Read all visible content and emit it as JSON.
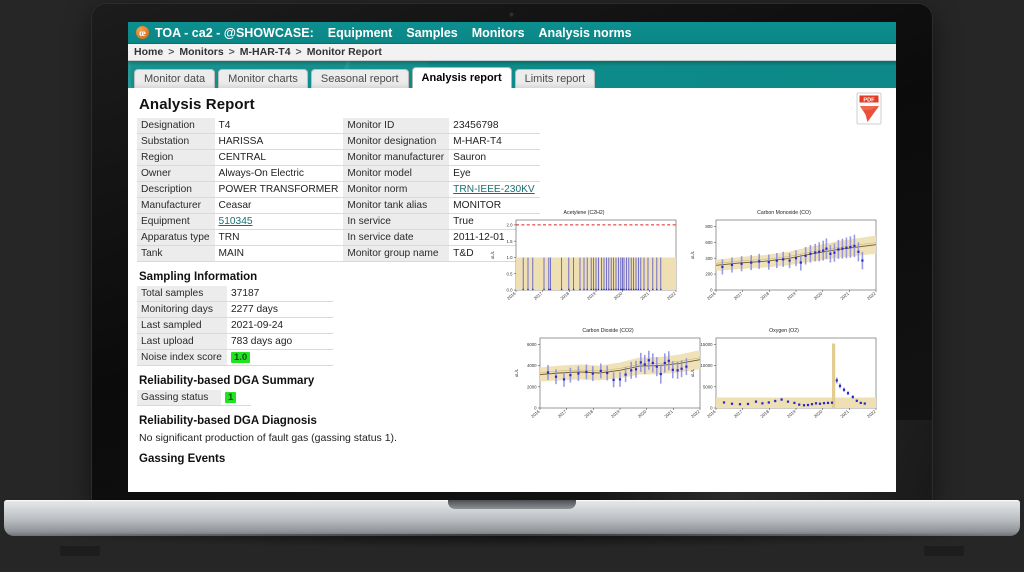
{
  "menubar": {
    "logo_text": "œ",
    "title": "TOA - ca2 - @SHOWCASE:",
    "items": [
      {
        "label": "Equipment"
      },
      {
        "label": "Samples"
      },
      {
        "label": "Monitors"
      },
      {
        "label": "Analysis norms"
      }
    ]
  },
  "breadcrumb": {
    "separator": ">",
    "items": [
      {
        "label": "Home"
      },
      {
        "label": "Monitors"
      },
      {
        "label": "M-HAR-T4"
      },
      {
        "label": "Monitor Report"
      }
    ]
  },
  "tabs": [
    {
      "label": "Monitor data",
      "active": false
    },
    {
      "label": "Monitor charts",
      "active": false
    },
    {
      "label": "Seasonal report",
      "active": false
    },
    {
      "label": "Analysis report",
      "active": true
    },
    {
      "label": "Limits report",
      "active": false
    }
  ],
  "export": {
    "icon": "pdf-icon",
    "label": "PDF"
  },
  "report": {
    "title": "Analysis Report",
    "info_rows": [
      {
        "k1": "Designation",
        "v1": "T4",
        "k2": "Monitor ID",
        "v2": "23456798"
      },
      {
        "k1": "Substation",
        "v1": "HARISSA",
        "k2": "Monitor designation",
        "v2": "M-HAR-T4"
      },
      {
        "k1": "Region",
        "v1": "CENTRAL",
        "k2": "Monitor manufacturer",
        "v2": "Sauron"
      },
      {
        "k1": "Owner",
        "v1": "Always-On Electric",
        "k2": "Monitor model",
        "v2": "Eye"
      },
      {
        "k1": "Description",
        "v1": "POWER TRANSFORMER",
        "k2": "Monitor norm",
        "v2": "TRN-IEEE-230KV",
        "v2_link": true
      },
      {
        "k1": "Manufacturer",
        "v1": "Ceasar",
        "k2": "Monitor tank alias",
        "v2": "MONITOR"
      },
      {
        "k1": "Equipment",
        "v1": "510345",
        "v1_link": true,
        "k2": "In service",
        "v2": "True"
      },
      {
        "k1": "Apparatus type",
        "v1": "TRN",
        "k2": "In service date",
        "v2": "2011-12-01"
      },
      {
        "k1": "Tank",
        "v1": "MAIN",
        "k2": "Monitor group name",
        "v2": "T&D"
      }
    ],
    "sampling": {
      "heading": "Sampling Information",
      "rows": [
        {
          "k": "Total samples",
          "v": "37187"
        },
        {
          "k": "Monitoring days",
          "v": "2277 days"
        },
        {
          "k": "Last sampled",
          "v": "2021-09-24"
        },
        {
          "k": "Last upload",
          "v": "783 days ago"
        },
        {
          "k": "Noise index score",
          "v": "1.0",
          "badge": true
        }
      ]
    },
    "dga_summary": {
      "heading": "Reliability-based DGA Summary",
      "rows": [
        {
          "k": "Gassing status",
          "v": "1",
          "badge": true
        }
      ]
    },
    "dga_diagnosis": {
      "heading": "Reliability-based DGA Diagnosis",
      "text": "No significant production of fault gas (gassing status 1)."
    },
    "gassing_events": {
      "heading": "Gassing Events"
    }
  },
  "colors": {
    "teal": "#0d8f8f",
    "badge_green": "#21e321",
    "band_tan": "#efe0b4",
    "marker_blue": "#2828c8",
    "trend_dark": "#6b5d20",
    "limit_red": "#e02020",
    "link": "#1a6f73"
  },
  "chart_data": [
    {
      "type": "scatter",
      "title": "Acetylene (C2H2)",
      "ylabel": "uL/L",
      "xlabel": "",
      "ylim": [
        0.0,
        2.15
      ],
      "yticks": [
        "0.0",
        "0.5",
        "1.0",
        "1.5",
        "2.0"
      ],
      "ytick_values": [
        0.0,
        0.5,
        1.0,
        1.5,
        2.0
      ],
      "xticks": [
        "2016",
        "2017",
        "2018",
        "2019",
        "2020",
        "2021",
        "2022"
      ],
      "limit_line": {
        "value": 2.0,
        "color": "#e02020",
        "style": "dashed"
      },
      "band": {
        "lower": 0.0,
        "upper": 1.0,
        "color": "#efe0b4"
      },
      "spikes_x": [
        0.045,
        0.075,
        0.105,
        0.175,
        0.205,
        0.215,
        0.285,
        0.33,
        0.36,
        0.4,
        0.425,
        0.445,
        0.47,
        0.485,
        0.5,
        0.515,
        0.535,
        0.55,
        0.565,
        0.58,
        0.595,
        0.61,
        0.625,
        0.64,
        0.655,
        0.665,
        0.675,
        0.69,
        0.705,
        0.72,
        0.735,
        0.75,
        0.765,
        0.78,
        0.8,
        0.825,
        0.855,
        0.88,
        0.905
      ],
      "spike_top": 1.0
    },
    {
      "type": "scatter",
      "title": "Carbon Monoxide (CO)",
      "ylabel": "uL/L",
      "xlabel": "",
      "ylim": [
        0,
        880
      ],
      "yticks": [
        "0",
        "200",
        "400",
        "600",
        "800"
      ],
      "ytick_values": [
        0,
        200,
        400,
        600,
        800
      ],
      "xticks": [
        "2016",
        "2017",
        "2018",
        "2019",
        "2020",
        "2021",
        "2022"
      ],
      "series": [
        {
          "name": "measurements",
          "x": [
            0.04,
            0.1,
            0.16,
            0.22,
            0.27,
            0.33,
            0.38,
            0.42,
            0.46,
            0.5,
            0.53,
            0.56,
            0.59,
            0.62,
            0.645,
            0.67,
            0.69,
            0.715,
            0.74,
            0.765,
            0.79,
            0.815,
            0.84,
            0.865,
            0.89,
            0.915
          ],
          "y": [
            290,
            315,
            330,
            345,
            360,
            350,
            370,
            385,
            370,
            400,
            345,
            430,
            455,
            470,
            480,
            495,
            520,
            455,
            470,
            510,
            520,
            530,
            540,
            555,
            480,
            370
          ],
          "yerr": [
            95,
            95,
            95,
            95,
            95,
            95,
            95,
            95,
            95,
            100,
            100,
            110,
            110,
            110,
            120,
            125,
            130,
            110,
            115,
            120,
            125,
            130,
            135,
            140,
            120,
            110
          ]
        },
        {
          "name": "trend",
          "x": [
            0.0,
            0.15,
            0.3,
            0.45,
            0.6,
            0.75,
            0.9,
            1.0
          ],
          "y": [
            310,
            340,
            360,
            395,
            455,
            505,
            545,
            570
          ]
        }
      ],
      "band": {
        "name": "confidence",
        "color": "#efe0b4"
      }
    },
    {
      "type": "scatter",
      "title": "Carbon Dioxide (CO2)",
      "ylabel": "uL/L",
      "xlabel": "",
      "ylim": [
        0,
        6600
      ],
      "yticks": [
        "0",
        "2000",
        "4000",
        "6000"
      ],
      "ytick_values": [
        0,
        2000,
        4000,
        6000
      ],
      "xticks": [
        "2016",
        "2017",
        "2018",
        "2019",
        "2020",
        "2021",
        "2022"
      ],
      "series": [
        {
          "name": "measurements",
          "x": [
            0.05,
            0.1,
            0.15,
            0.19,
            0.24,
            0.29,
            0.33,
            0.38,
            0.42,
            0.46,
            0.5,
            0.535,
            0.57,
            0.6,
            0.63,
            0.655,
            0.68,
            0.705,
            0.73,
            0.755,
            0.78,
            0.805,
            0.83,
            0.86,
            0.885,
            0.915
          ],
          "y": [
            3350,
            2950,
            2700,
            3100,
            3250,
            3400,
            3250,
            3500,
            3300,
            2650,
            2700,
            3150,
            3550,
            3650,
            4300,
            4100,
            4500,
            4250,
            3900,
            3200,
            4250,
            4450,
            3600,
            3550,
            3700,
            3900
          ],
          "yerr": [
            700,
            700,
            700,
            700,
            700,
            700,
            700,
            700,
            700,
            700,
            700,
            700,
            800,
            800,
            900,
            900,
            900,
            900,
            900,
            900,
            900,
            900,
            800,
            800,
            800,
            800
          ]
        },
        {
          "name": "trend",
          "x": [
            0.0,
            0.12,
            0.25,
            0.37,
            0.5,
            0.62,
            0.75,
            0.87,
            1.0
          ],
          "y": [
            3150,
            3300,
            3400,
            3300,
            3550,
            3950,
            4000,
            4200,
            4550
          ]
        }
      ],
      "band": {
        "name": "confidence",
        "color": "#efe0b4"
      }
    },
    {
      "type": "scatter",
      "title": "Oxygen (O2)",
      "ylabel": "uL/L",
      "xlabel": "",
      "ylim": [
        0,
        16500
      ],
      "yticks": [
        "0",
        "5000",
        "10000",
        "15000"
      ],
      "ytick_values": [
        0,
        5000,
        10000,
        15000
      ],
      "xticks": [
        "2016",
        "2017",
        "2018",
        "2019",
        "2020",
        "2021",
        "2022"
      ],
      "series": [
        {
          "name": "measurements",
          "x": [
            0.05,
            0.1,
            0.15,
            0.2,
            0.25,
            0.29,
            0.33,
            0.37,
            0.41,
            0.45,
            0.49,
            0.52,
            0.55,
            0.575,
            0.6,
            0.625,
            0.65,
            0.675,
            0.7,
            0.725,
            0.755,
            0.775,
            0.8,
            0.825,
            0.855,
            0.88,
            0.905,
            0.93
          ],
          "y": [
            1300,
            1000,
            900,
            950,
            1500,
            1100,
            1300,
            1650,
            2000,
            1500,
            1200,
            800,
            650,
            700,
            900,
            1100,
            1000,
            1150,
            1200,
            1250,
            6500,
            5200,
            4300,
            3500,
            2600,
            1700,
            1200,
            1050
          ],
          "yerr": [
            250,
            250,
            250,
            250,
            300,
            250,
            250,
            300,
            300,
            250,
            250,
            250,
            250,
            250,
            250,
            250,
            250,
            250,
            250,
            250,
            700,
            600,
            500,
            450,
            400,
            300,
            250,
            250
          ]
        }
      ],
      "band": {
        "name": "confidence",
        "color": "#efe0b4"
      },
      "spike": {
        "x": 0.735,
        "top": 15200
      }
    }
  ]
}
